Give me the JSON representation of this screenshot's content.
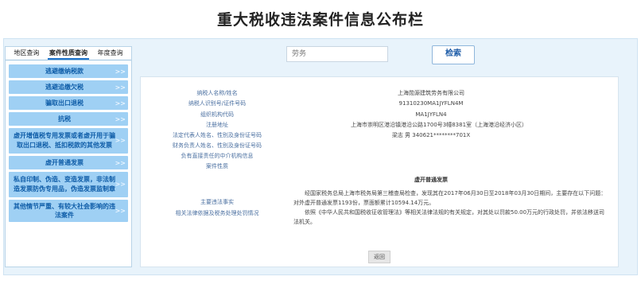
{
  "page_title": "重大税收违法案件信息公布栏",
  "tabs": [
    {
      "label": "地区查询"
    },
    {
      "label": "案件性质查询"
    },
    {
      "label": "年度查询"
    }
  ],
  "nav_items": [
    {
      "label": "逃避缴纳税款"
    },
    {
      "label": "逃避追缴欠税"
    },
    {
      "label": "骗取出口退税"
    },
    {
      "label": "抗税"
    },
    {
      "label": "虚开增值税专用发票或者虚开用于骗取出口退税、抵扣税款的其他发票"
    },
    {
      "label": "虚开普通发票"
    },
    {
      "label": "私自印制、伪造、变造发票，非法制造发票防伪专用品，伪造发票监制章"
    },
    {
      "label": "其他情节严重、有较大社会影响的违法案件"
    }
  ],
  "search": {
    "placeholder": "劳务",
    "button_label": "检索"
  },
  "fields": [
    {
      "label": "纳税人名称/姓名",
      "value": "上海勋源建筑劳务有限公司"
    },
    {
      "label": "纳税人识别号/证件号码",
      "value": "91310230MA1JYFLN4M"
    },
    {
      "label": "组织机构代码",
      "value": "MA1JYFLN4"
    },
    {
      "label": "注册地址",
      "value": "上海市崇明区港沿镇港沿公路1700号3幢8381室（上海港沿经济小区）"
    },
    {
      "label": "法定代表人姓名、性别及身份证号码",
      "value": "梁志   男   340621********701X"
    },
    {
      "label": "财务负责人姓名、性别及身份证号码",
      "value": ""
    },
    {
      "label": "负有直接责任的中介机构信息",
      "value": ""
    },
    {
      "label": "案件性质",
      "value": ""
    }
  ],
  "case": {
    "title": "虚开普通发票",
    "main_facts_label": "主要违法事实",
    "legal_basis_label": "相关法律依据及税务处理处罚情况",
    "paragraph1": "经国家税务总局上海市税务局第三稽查局检查，发现其在2017年06月30日至2018年03月30日期间，主要存在以下问题：对外虚开普通发票1193份，票面额累计10594.14万元。",
    "paragraph2": "依照《中华人民共和国税收征收管理法》等相关法律法规的有关规定，对其处以罚款50.00万元的行政处罚，并依法移送司法机关。"
  },
  "back_button_label": "返回"
}
